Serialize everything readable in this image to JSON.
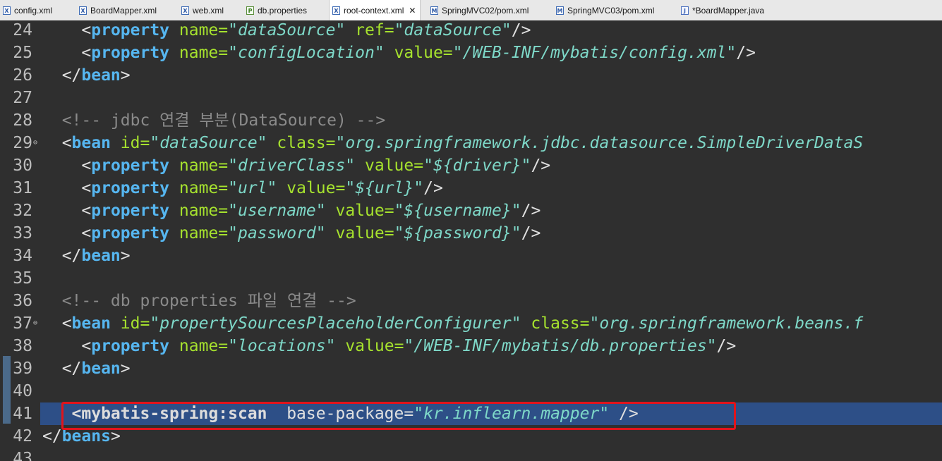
{
  "tabs": [
    {
      "label": "config.xml",
      "icon": "xml-file-icon",
      "active": false
    },
    {
      "label": "BoardMapper.xml",
      "icon": "xml-file-icon",
      "active": false
    },
    {
      "label": "web.xml",
      "icon": "xml-file-icon",
      "active": false
    },
    {
      "label": "db.properties",
      "icon": "properties-file-icon",
      "active": false
    },
    {
      "label": "root-context.xml",
      "icon": "xml-file-icon",
      "active": true,
      "close": "✕"
    },
    {
      "label": "SpringMVC02/pom.xml",
      "icon": "maven-file-icon",
      "active": false
    },
    {
      "label": "SpringMVC03/pom.xml",
      "icon": "maven-file-icon",
      "active": false
    },
    {
      "label": "*BoardMapper.java",
      "icon": "java-file-icon",
      "active": false
    }
  ],
  "lines": [
    {
      "n": "24",
      "t": [
        [
          "    ",
          "br"
        ],
        [
          "<",
          "br"
        ],
        [
          "property",
          "tag"
        ],
        [
          " ",
          "br"
        ],
        [
          "name=",
          "attr"
        ],
        [
          "\"dataSource\"",
          "str"
        ],
        [
          " ",
          "br"
        ],
        [
          "ref=",
          "attr"
        ],
        [
          "\"dataSource\"",
          "str"
        ],
        [
          "/>",
          "br"
        ]
      ]
    },
    {
      "n": "25",
      "t": [
        [
          "    ",
          "br"
        ],
        [
          "<",
          "br"
        ],
        [
          "property",
          "tag"
        ],
        [
          " ",
          "br"
        ],
        [
          "name=",
          "attr"
        ],
        [
          "\"configLocation\"",
          "str"
        ],
        [
          " ",
          "br"
        ],
        [
          "value=",
          "attr"
        ],
        [
          "\"/WEB-INF/mybatis/config.xml\"",
          "str"
        ],
        [
          "/>",
          "br"
        ]
      ]
    },
    {
      "n": "26",
      "t": [
        [
          "  </",
          "br"
        ],
        [
          "bean",
          "tag"
        ],
        [
          ">",
          "br"
        ]
      ]
    },
    {
      "n": "27",
      "t": []
    },
    {
      "n": "28",
      "t": [
        [
          "  <!-- jdbc 연결 부분(DataSource) -->",
          "com"
        ]
      ]
    },
    {
      "n": "29",
      "fold": true,
      "t": [
        [
          "  <",
          "br"
        ],
        [
          "bean",
          "tag"
        ],
        [
          " ",
          "br"
        ],
        [
          "id=",
          "attr"
        ],
        [
          "\"dataSource\"",
          "str"
        ],
        [
          " ",
          "br"
        ],
        [
          "class=",
          "attr"
        ],
        [
          "\"org.springframework.jdbc.datasource.SimpleDriverDataS",
          "str"
        ]
      ]
    },
    {
      "n": "30",
      "t": [
        [
          "    <",
          "br"
        ],
        [
          "property",
          "tag"
        ],
        [
          " ",
          "br"
        ],
        [
          "name=",
          "attr"
        ],
        [
          "\"driverClass\"",
          "str"
        ],
        [
          " ",
          "br"
        ],
        [
          "value=",
          "attr"
        ],
        [
          "\"${driver}\"",
          "str"
        ],
        [
          "/>",
          "br"
        ]
      ]
    },
    {
      "n": "31",
      "t": [
        [
          "    <",
          "br"
        ],
        [
          "property",
          "tag"
        ],
        [
          " ",
          "br"
        ],
        [
          "name=",
          "attr"
        ],
        [
          "\"url\"",
          "str"
        ],
        [
          " ",
          "br"
        ],
        [
          "value=",
          "attr"
        ],
        [
          "\"${url}\"",
          "str"
        ],
        [
          "/>",
          "br"
        ]
      ]
    },
    {
      "n": "32",
      "t": [
        [
          "    <",
          "br"
        ],
        [
          "property",
          "tag"
        ],
        [
          " ",
          "br"
        ],
        [
          "name=",
          "attr"
        ],
        [
          "\"username\"",
          "str"
        ],
        [
          " ",
          "br"
        ],
        [
          "value=",
          "attr"
        ],
        [
          "\"${username}\"",
          "str"
        ],
        [
          "/>",
          "br"
        ]
      ]
    },
    {
      "n": "33",
      "t": [
        [
          "    <",
          "br"
        ],
        [
          "property",
          "tag"
        ],
        [
          " ",
          "br"
        ],
        [
          "name=",
          "attr"
        ],
        [
          "\"password\"",
          "str"
        ],
        [
          " ",
          "br"
        ],
        [
          "value=",
          "attr"
        ],
        [
          "\"${password}\"",
          "str"
        ],
        [
          "/>",
          "br"
        ]
      ]
    },
    {
      "n": "34",
      "t": [
        [
          "  </",
          "br"
        ],
        [
          "bean",
          "tag"
        ],
        [
          ">",
          "br"
        ]
      ]
    },
    {
      "n": "35",
      "t": []
    },
    {
      "n": "36",
      "t": [
        [
          "  <!-- db properties 파일 연결 -->",
          "com"
        ]
      ]
    },
    {
      "n": "37",
      "fold": true,
      "t": [
        [
          "  <",
          "br"
        ],
        [
          "bean",
          "tag"
        ],
        [
          " ",
          "br"
        ],
        [
          "id=",
          "attr"
        ],
        [
          "\"propertySourcesPlaceholderConfigurer\"",
          "str"
        ],
        [
          " ",
          "br"
        ],
        [
          "class=",
          "attr"
        ],
        [
          "\"org.springframework.beans.f",
          "str"
        ]
      ]
    },
    {
      "n": "38",
      "t": [
        [
          "    <",
          "br"
        ],
        [
          "property",
          "tag"
        ],
        [
          " ",
          "br"
        ],
        [
          "name=",
          "attr"
        ],
        [
          "\"locations\"",
          "str"
        ],
        [
          " ",
          "br"
        ],
        [
          "value=",
          "attr"
        ],
        [
          "\"/WEB-INF/mybatis/db.properties\"",
          "str"
        ],
        [
          "/>",
          "br"
        ]
      ]
    },
    {
      "n": "39",
      "t": [
        [
          "  </",
          "br"
        ],
        [
          "bean",
          "tag"
        ],
        [
          ">",
          "br"
        ]
      ]
    },
    {
      "n": "40",
      "t": []
    },
    {
      "n": "41",
      "highlight": true,
      "t": [
        [
          "   <mybatis-spring:scan",
          "hl"
        ],
        [
          "  base-package=",
          "br"
        ],
        [
          "\"kr.inflearn.mapper\"",
          "str"
        ],
        [
          " />",
          "br"
        ]
      ]
    },
    {
      "n": "42",
      "t": [
        [
          "</",
          "br"
        ],
        [
          "beans",
          "tag"
        ],
        [
          ">",
          "br"
        ]
      ]
    },
    {
      "n": "43",
      "t": []
    }
  ]
}
